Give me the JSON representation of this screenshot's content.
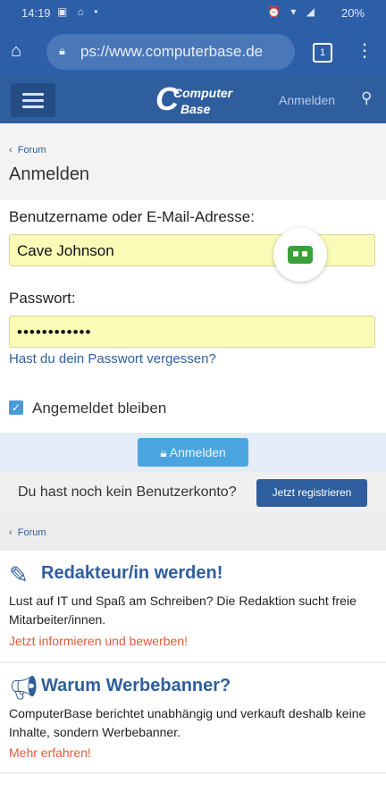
{
  "status_bar": {
    "time": "14:19",
    "battery": "20%"
  },
  "browser": {
    "url": "ps://www.computerbase.de",
    "tab_count": "1"
  },
  "site_header": {
    "logo_top": "Computer",
    "logo_bottom": "Base",
    "logo_letter": "C",
    "login_link": "Anmelden"
  },
  "breadcrumb": {
    "label": "Forum"
  },
  "page": {
    "title": "Anmelden"
  },
  "form": {
    "username_label": "Benutzername oder E-Mail-Adresse:",
    "username_value": "Cave Johnson",
    "password_label": "Passwort:",
    "password_value": "••••••••••••",
    "forgot_link": "Hast du dein Passwort vergessen?",
    "stay_logged_in": "Angemeldet bleiben",
    "stay_logged_in_checked": true,
    "submit": "Anmelden"
  },
  "register": {
    "text": "Du hast noch kein Benutzerkonto?",
    "button": "Jetzt registrieren"
  },
  "footer_breadcrumb": {
    "label": "Forum"
  },
  "promos": [
    {
      "icon": "pen-icon",
      "title": "Redakteur/in werden!",
      "text": "Lust auf IT und Spaß am Schreiben? Die Redaktion sucht freie Mitarbeiter/innen.",
      "link": "Jetzt informieren und bewerben!"
    },
    {
      "icon": "megaphone-icon",
      "title": "Warum Werbebanner?",
      "text": "ComputerBase berichtet unabhängig und verkauft deshalb keine Inhalte, sondern Werbebanner.",
      "link": "Mehr erfahren!"
    }
  ],
  "colors": {
    "brand_blue": "#2f5e9e",
    "autofill_yellow": "#fbfbb8",
    "accent_orange": "#e05a3a",
    "submit_light_blue": "#4aa4e0"
  }
}
